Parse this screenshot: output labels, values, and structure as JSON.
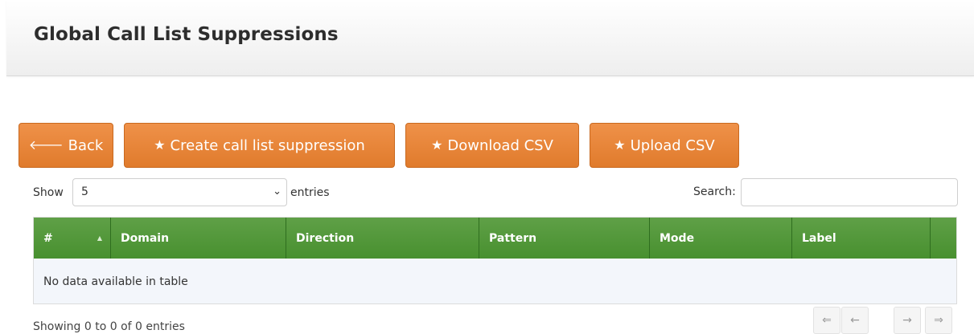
{
  "header": {
    "title": "Global Call List Suppressions"
  },
  "toolbar": {
    "back_label": "Back",
    "back_icon": "arrow-left-icon",
    "create_label": "Create call list suppression",
    "download_label": "Download CSV",
    "upload_label": "Upload CSV",
    "star_icon": "star-icon",
    "accent_color": "#e8843a"
  },
  "controls": {
    "show_label": "Show",
    "page_size": "5",
    "entries_label": "entries",
    "search_label": "Search:",
    "search_value": ""
  },
  "table": {
    "header_color": "#52962f",
    "columns": [
      "#",
      "Domain",
      "Direction",
      "Pattern",
      "Mode",
      "Label",
      ""
    ],
    "sorted_column": "#",
    "sort_direction": "ascending",
    "rows": [],
    "empty_message": "No data available in table"
  },
  "footer": {
    "info": "Showing 0 to 0 of 0 entries",
    "pager": [
      "⇐",
      "←",
      "→",
      "⇒"
    ]
  }
}
